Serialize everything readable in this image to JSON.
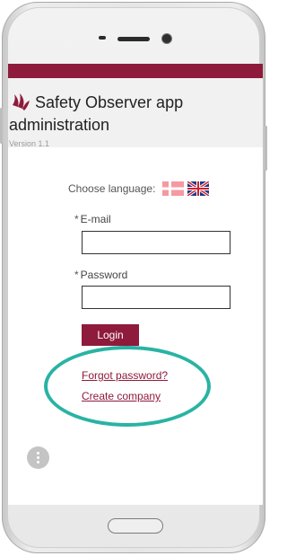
{
  "app": {
    "title_line1": "Safety Observer app",
    "title_line2": "administration",
    "version": "Version 1.1"
  },
  "language": {
    "label": "Choose language:",
    "options": [
      "Danish",
      "English"
    ]
  },
  "form": {
    "required_marker": "*",
    "email_label": "E-mail",
    "email_value": "",
    "password_label": "Password",
    "password_value": "",
    "login_label": "Login"
  },
  "links": {
    "forgot_password": "Forgot password?",
    "create_company": "Create company"
  },
  "colors": {
    "brand": "#8e1a3c",
    "highlight": "#29b3a3"
  },
  "icons": {
    "logo": "company-logo-icon",
    "menu": "more-vertical-icon"
  }
}
